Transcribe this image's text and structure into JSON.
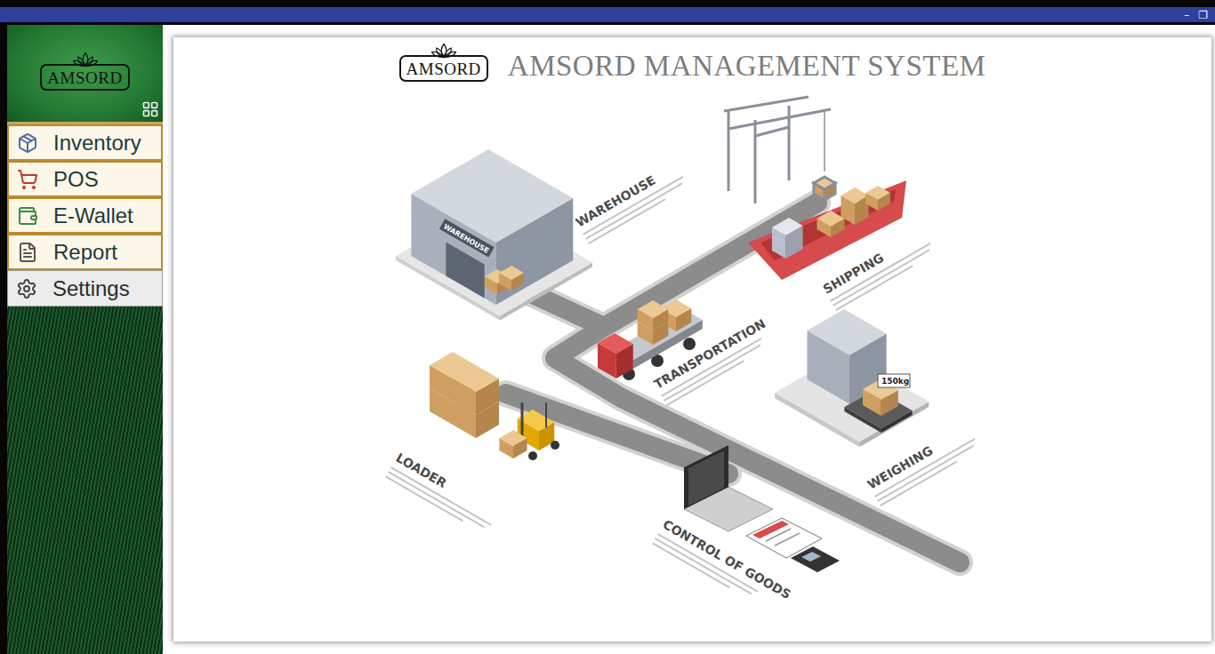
{
  "window": {
    "controls": [
      "–",
      "❐"
    ]
  },
  "sidebar": {
    "logo": "AMSORD",
    "items": [
      {
        "label": "Inventory",
        "selected": false
      },
      {
        "label": "POS",
        "selected": false
      },
      {
        "label": "E-Wallet",
        "selected": false
      },
      {
        "label": "Report",
        "selected": false
      },
      {
        "label": "Settings",
        "selected": true
      }
    ]
  },
  "header": {
    "logo": "AMSORD",
    "title": "AMSORD MANAGEMENT SYSTEM"
  },
  "illustration": {
    "labels": [
      "WAREHOUSE",
      "SHIPPING",
      "TRANSPORTATION",
      "WEIGHING",
      "LOADER",
      "CONTROL OF GOODS"
    ],
    "warehouse_sign": "WAREHOUSE",
    "scale_reading": "150kg"
  }
}
